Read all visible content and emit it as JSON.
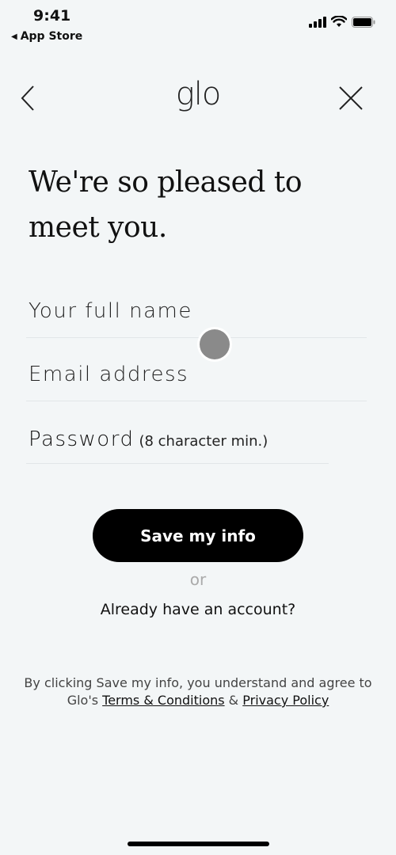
{
  "status_bar": {
    "time": "9:41",
    "back_app": "App Store",
    "icons": [
      "cellular-signal-icon",
      "wifi-icon",
      "battery-icon"
    ]
  },
  "nav": {
    "back_icon": "chevron-left-icon",
    "logo": "glo",
    "close_icon": "close-icon"
  },
  "heading": "We're so pleased to meet you.",
  "form": {
    "full_name": {
      "placeholder": "Your full name",
      "value": ""
    },
    "email": {
      "placeholder": "Email address",
      "value": ""
    },
    "password": {
      "placeholder": "Password",
      "hint": "(8 character min.)",
      "value": ""
    }
  },
  "actions": {
    "save_label": "Save my info",
    "or_label": "or",
    "login_link": "Already have an account?"
  },
  "legal": {
    "prefix": "By clicking Save my info, you understand and agree to Glo's ",
    "terms_link": "Terms & Conditions",
    "joiner": " & ",
    "privacy_link": "Privacy Policy"
  },
  "colors": {
    "background": "#f3f6f7",
    "primary_button": "#000000",
    "muted_text": "#aaaaaa"
  }
}
